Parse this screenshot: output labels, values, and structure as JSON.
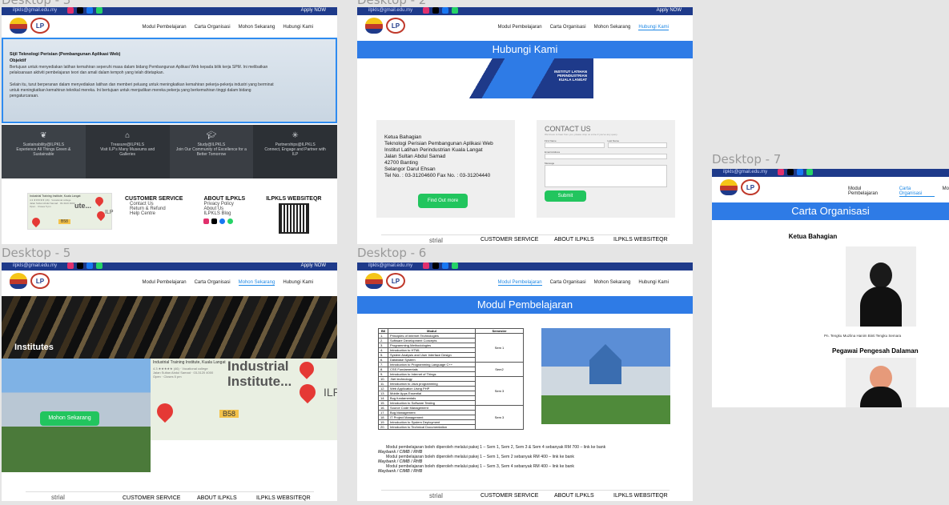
{
  "frames": {
    "d3": {
      "label": "Desktop - 3"
    },
    "d2": {
      "label": "Desktop - 2"
    },
    "d7": {
      "label": "Desktop - 7"
    },
    "d5": {
      "label": "Desktop - 5"
    },
    "d6": {
      "label": "Desktop - 6"
    }
  },
  "topbar": {
    "email": "ilpkls@gmail.edu.my",
    "apply": "Apply NOW"
  },
  "nav": {
    "modul": "Modul Pembelajaran",
    "carta": "Carta Organisasi",
    "mohon": "Mohon Sekarang",
    "hubungi": "Hubungi Kami",
    "mo": "Mo"
  },
  "logo": {
    "lp": "LP"
  },
  "home": {
    "title": "Sijil Teknologi Perisian (Pembangunan Aplikasi Web)",
    "subtitle": "Objektif",
    "para1": "Bertujuan untuk menyediakan latihan kemahiran seperuhi masa dalam bidang Pembangunan Aplikasi Web kepada bilik kerja SPM. Ini melibatkan pelaksanaan  aktiviti pembelajaran teori dan amali dalam tempoh yang telah ditetapkan.",
    "para2": "Selain itu, turut berperanan dalam menyediakan latihan dan memberi peluang untuk meningkatkan kemahiran pekerja-pekerja industri yang berminat untuk meningkatkan kemahiran teknikal mereka. Ini bertujuan untuk menjadikan mereka pekerja yang berkemahiran tinggi dalam bidang pengaturcaraan.",
    "tiles": [
      {
        "title": "Sustainability@ILPKLS",
        "desc": "Experience All Things Green & Sustainable"
      },
      {
        "title": "Treasure@ILPKLS",
        "desc": "Visit ILP's Many Museums and Galleries"
      },
      {
        "title": "Study@ILPKLS",
        "desc": "Join Our Community of Excellence for a Better Tomorrow"
      },
      {
        "title": "Partnerships@ILPKLS",
        "desc": "Connect, Engage and Partner with ILP"
      }
    ]
  },
  "footer": {
    "cs_title": "CUSTOMER SERVICE",
    "cs_items": [
      "Contact Us",
      "Return & Refund",
      "Help Centre"
    ],
    "about_title": "ABOUT ILPKLS",
    "about_items": [
      "Privacy Policy",
      "About Us",
      "ILPKLS Blog"
    ],
    "web_title": "ILPKLS WEBSITEQR",
    "map_name": "Industrial Training Institute, Kuala Langat",
    "map_rating": "4.3 ★★★★★ (46) · Vocational college",
    "map_addr": "Jalan Sultan Abdul Samad · 03-3120 4000",
    "map_open": "Open · Closes 5 pm",
    "map_big": "Industrial Institute...",
    "map_small": "ute...",
    "map_ilp": "ILP",
    "map_road": "B58",
    "map_strial": "strial"
  },
  "contact": {
    "band": "Hubungi Kami",
    "banner_line1": "INSTITUT LATIHAN",
    "banner_line2": "PERINDUSTRIAN",
    "banner_line3": "KUALA LANGAT",
    "address": [
      "Ketua Bahagian",
      "Teknologi Perisian Pembangunan Aplikasi Web",
      "Institut Latihan Perindustrian Kuala Langat",
      "Jalan Sultan Abdul Samad",
      "42700 Banting",
      "Selangor Darul Ehsan",
      "Tel No. : 03-31204600 Fax No. : 03-31204440"
    ],
    "find_out": "Find Out more",
    "form_title": "CONTACT US",
    "form_sub": "We'd love to hear from you, please drop us a line if you've any query.",
    "first_name": "First Name",
    "last_name": "Last Name",
    "email": "Email Address",
    "message": "Message",
    "submit": "Submit"
  },
  "apply": {
    "institutes": "Institutes",
    "mohon_btn": "Mohon Sekarang"
  },
  "modul": {
    "band": "Modul Pembelajaran",
    "headers": [
      "Bil",
      "Modul",
      "Semester"
    ],
    "rows": [
      [
        "1.",
        "Principles of Internet Technologies"
      ],
      [
        "2.",
        "Software Development Concepts"
      ],
      [
        "3.",
        "Programming Methodologies"
      ],
      [
        "4.",
        "Introduction to HTML"
      ],
      [
        "5.",
        "System Analysis and User Interface Design"
      ],
      [
        "6.",
        "Database System"
      ],
      [
        "7.",
        "Introduction to Programming Language C++"
      ],
      [
        "8.",
        "CSS Fundamentals"
      ],
      [
        "9.",
        "Introduction to Internet of Things"
      ],
      [
        "10.",
        ".Net technology"
      ],
      [
        "11.",
        "Introduction to Java programming"
      ],
      [
        "12.",
        "Web Application Using PHP"
      ],
      [
        "13.",
        "Mobile Apps Essential"
      ],
      [
        "14.",
        "Bug fundamentals"
      ],
      [
        "15.",
        "Introduction to Software Testing"
      ],
      [
        "16.",
        "Source Code Management"
      ],
      [
        "17.",
        "Bug Management"
      ],
      [
        "18.",
        "IT Project Management"
      ],
      [
        "19.",
        "Introduction to System Deployment"
      ],
      [
        "20.",
        "Introduction to Technical Documentation"
      ]
    ],
    "sems": [
      "Sem 1",
      "Sem2",
      "Sem 3",
      "Sem 3"
    ],
    "pay": [
      "Modul pembelajaran boleh diperoleh melalui pakej 1 – Sem 1, Sem 2, Sem 3 & Sem 4 sebanyak RM 700 – link ke bank",
      "Modul pembelajaran boleh diperoleh melalui pakej 1 – Sem 1, Sem 2 sebanyak RM 400 – link ke bank",
      "Modul pembelajaran boleh diperoleh melalui pakej 1 – Sem 3, Sem 4 sebanyak RM 400 – link ke bank"
    ],
    "banks": "Maybank  / CIMB  / RHB"
  },
  "carta": {
    "band": "Carta Organisasi",
    "role1": "Ketua Bahagian",
    "name1": "Pn. Tengku Muzlina Hanim Binti Tengku Semara",
    "role2": "Pegawai Pengesah Dalaman"
  },
  "colors": {
    "brand_blue": "#2e7be6",
    "dark_blue": "#1e3a8a",
    "green": "#22c55e"
  }
}
